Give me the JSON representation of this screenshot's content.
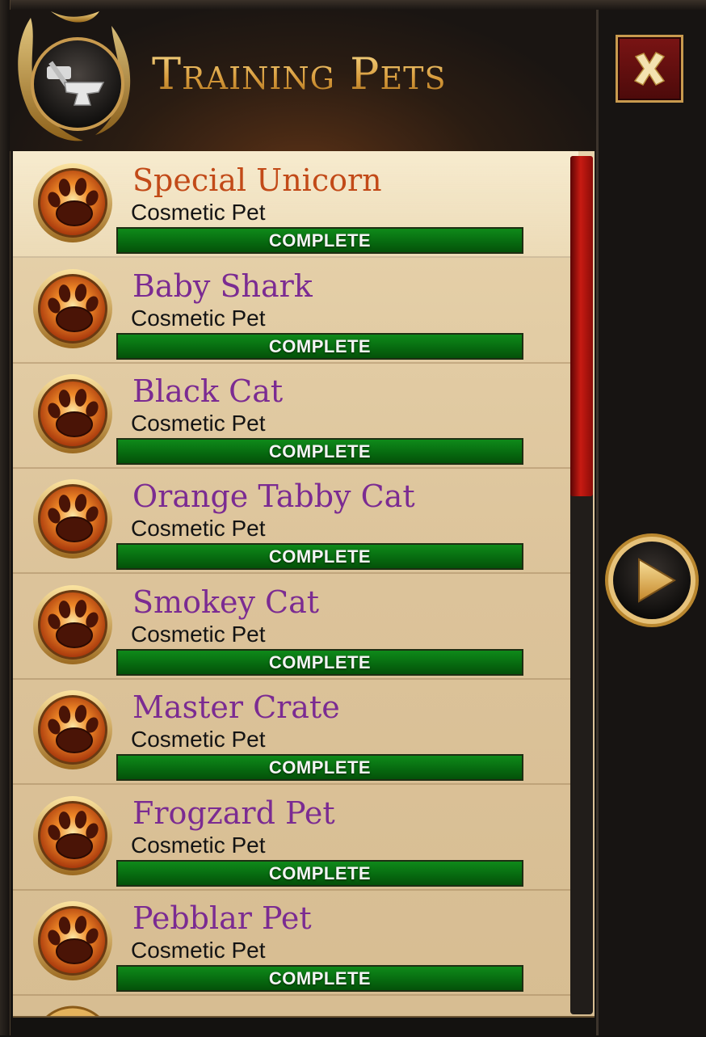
{
  "header": {
    "title": "Training Pets",
    "emblem_icon": "anvil-hammer-icon"
  },
  "buttons": {
    "close_icon": "close-icon",
    "next_icon": "play-arrow-icon"
  },
  "colors": {
    "accent_gold": "#e8b75a",
    "rare_name": "#c24a18",
    "epic_name": "#7b2b92",
    "complete_bar": "#087a12",
    "scroll_thumb": "#c71b12"
  },
  "pets": [
    {
      "name": "Special Unicorn",
      "type": "Cosmetic Pet",
      "status": "COMPLETE",
      "name_color": "#c24a18",
      "icon": "paw-icon"
    },
    {
      "name": "Baby Shark",
      "type": "Cosmetic Pet",
      "status": "COMPLETE",
      "name_color": "#7b2b92",
      "icon": "paw-icon"
    },
    {
      "name": "Black Cat",
      "type": "Cosmetic Pet",
      "status": "COMPLETE",
      "name_color": "#7b2b92",
      "icon": "paw-icon"
    },
    {
      "name": "Orange Tabby Cat",
      "type": "Cosmetic Pet",
      "status": "COMPLETE",
      "name_color": "#7b2b92",
      "icon": "paw-icon"
    },
    {
      "name": "Smokey Cat",
      "type": "Cosmetic Pet",
      "status": "COMPLETE",
      "name_color": "#7b2b92",
      "icon": "paw-icon"
    },
    {
      "name": "Master Crate",
      "type": "Cosmetic Pet",
      "status": "COMPLETE",
      "name_color": "#7b2b92",
      "icon": "paw-icon"
    },
    {
      "name": "Frogzard Pet",
      "type": "Cosmetic Pet",
      "status": "COMPLETE",
      "name_color": "#7b2b92",
      "icon": "paw-icon"
    },
    {
      "name": "Pebblar Pet",
      "type": "Cosmetic Pet",
      "status": "COMPLETE",
      "name_color": "#7b2b92",
      "icon": "paw-icon"
    }
  ],
  "scrollbar": {
    "position_fraction": 0
  }
}
